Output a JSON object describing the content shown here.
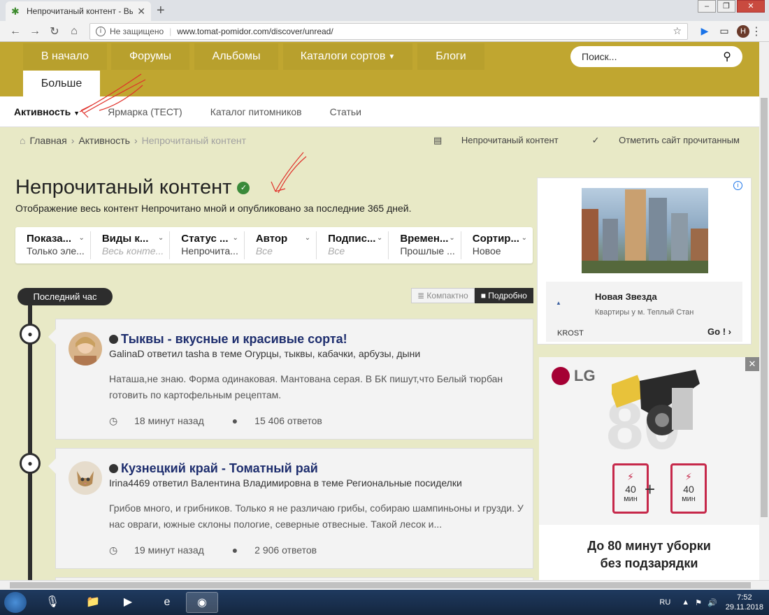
{
  "browser": {
    "tab_title": "Непрочитаный контент - Выращ",
    "tab_close": "✕",
    "new_tab": "+",
    "insecure_label": "Не защищено",
    "url": "www.tomat-pomidor.com/discover/unread/",
    "profile_initial": "Н"
  },
  "nav": {
    "items": [
      "В начало",
      "Форумы",
      "Альбомы",
      "Каталоги сортов",
      "Блоги"
    ],
    "more": "Больше",
    "search_placeholder": "Поиск..."
  },
  "subnav": {
    "items": [
      "Активность",
      "Ярмарка (ТЕСТ)",
      "Каталог питомников",
      "Статьи"
    ]
  },
  "breadcrumbs": {
    "items": [
      "Главная",
      "Активность",
      "Непрочитаный контент"
    ],
    "actions": [
      "Непрочитаный контент",
      "Отметить сайт прочитанным"
    ]
  },
  "page": {
    "title": "Непрочитаный контент",
    "subtitle": "Отображение весь контент Непрочитано мной и опубликовано за последние 365 дней."
  },
  "filters": [
    {
      "label": "Показа...",
      "value": "Только эле...",
      "placeholder": false
    },
    {
      "label": "Виды к...",
      "value": "Весь конте...",
      "placeholder": true
    },
    {
      "label": "Статус ...",
      "value": "Непрочита...",
      "placeholder": false
    },
    {
      "label": "Автор",
      "value": "Все",
      "placeholder": true
    },
    {
      "label": "Подпис...",
      "value": "Все",
      "placeholder": true
    },
    {
      "label": "Времен...",
      "value": "Прошлые ...",
      "placeholder": false
    },
    {
      "label": "Сортир...",
      "value": "Новое",
      "placeholder": false
    }
  ],
  "timeline": {
    "label": "Последний час"
  },
  "view_toggle": {
    "compact": "Компактно",
    "detailed": "Подробно"
  },
  "items": [
    {
      "title": "Тыквы - вкусные и красивые сорта!",
      "meta": "GalinaD ответил tasha в теме Огурцы, тыквы, кабачки, арбузы, дыни",
      "body": "Наташа,не знаю. Форма одинаковая. Мантована серая. В БК пишут,что Белый тюрбан готовить по картофельным рецептам.",
      "time": "18 минут назад",
      "replies": "15 406 ответов"
    },
    {
      "title": "Кузнецкий край - Томатный рай",
      "meta": "Irina4469 ответил Валентина Владимировна в теме Региональные посиделки",
      "body": "Грибов много, и грибников. Только я не различаю грибы, собираю шампиньоны и грузди. У нас овраги, южные склоны пологие, северные отвесные. Такой лесок и...",
      "time": "19 минут назад",
      "replies": "2 906 ответов"
    }
  ],
  "ad1": {
    "name": "Новая Звезда",
    "desc": "Квартиры у м. Теплый Стан",
    "brand": "KROST",
    "go": "Go !",
    "logo_text": "KROST"
  },
  "ad2": {
    "brand": "LG",
    "big_number": "80",
    "battery_value": "40",
    "battery_unit": "мин",
    "cta_line1": "До 80 минут уборки",
    "cta_line2": "без подзарядки"
  },
  "taskbar": {
    "lang": "RU",
    "time": "7:52",
    "date": "29.11.2018"
  },
  "colors": {
    "header_gold": "#c0a630",
    "page_bg": "#e8e9c6",
    "title_blue": "#1e2e6e",
    "timeline_dark": "#2d2d2d"
  }
}
